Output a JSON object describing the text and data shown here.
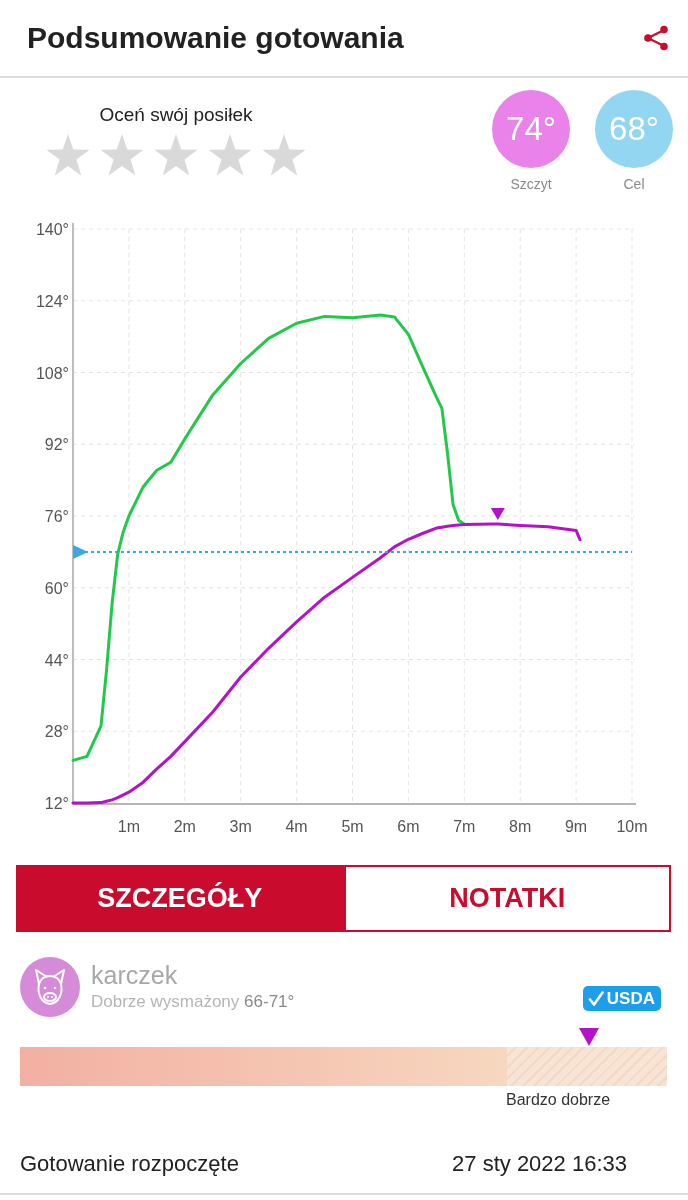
{
  "header": {
    "title": "Podsumowanie gotowania"
  },
  "rating": {
    "label": "Oceń swój posiłek",
    "stars": 0
  },
  "readings": [
    {
      "value": "74°",
      "label": "Szczyt",
      "color": "#e982e9"
    },
    {
      "value": "68°",
      "label": "Cel",
      "color": "#93d6f2"
    }
  ],
  "chart": {
    "chart_data": {
      "type": "line",
      "x": [
        0,
        0.25,
        0.5,
        0.6,
        0.7,
        0.8,
        0.9,
        1,
        1.25,
        1.5,
        1.75,
        2,
        2.5,
        3,
        3.5,
        4,
        4.5,
        5,
        5.5,
        5.75,
        6,
        6.25,
        6.5,
        6.6,
        6.7,
        6.8,
        6.9,
        7,
        7.5,
        7.6,
        8,
        8.5,
        9,
        9.07
      ],
      "series": [
        {
          "color": "#22c84a",
          "values": [
            21.5,
            22.4,
            29.2,
            41.5,
            56.5,
            67.5,
            72.5,
            76,
            82.4,
            86.2,
            88,
            93.2,
            103,
            110,
            115.6,
            119,
            120.5,
            120.2,
            120.8,
            120.4,
            116.5,
            109.4,
            102.5,
            100,
            90,
            78.5,
            75,
            74.2,
            null,
            null,
            null,
            null,
            null,
            null
          ]
        },
        {
          "color": "#b412c8",
          "values": [
            12,
            12,
            12.1,
            12.4,
            12.7,
            13.2,
            13.8,
            14.4,
            16.6,
            19.6,
            22.4,
            25.7,
            32.3,
            40.1,
            46.5,
            52.4,
            57.9,
            62.3,
            66.7,
            69.1,
            70.8,
            72.1,
            73.3,
            73.5,
            73.7,
            73.9,
            74,
            74.1,
            74.2,
            74.2,
            73.9,
            73.6,
            72.8,
            70.7
          ]
        }
      ],
      "xlim": [
        0,
        10
      ],
      "ylim": [
        12,
        140
      ],
      "xticks": [
        {
          "value": 1,
          "label": "1m"
        },
        {
          "value": 2,
          "label": "2m"
        },
        {
          "value": 3,
          "label": "3m"
        },
        {
          "value": 4,
          "label": "4m"
        },
        {
          "value": 5,
          "label": "5m"
        },
        {
          "value": 6,
          "label": "6m"
        },
        {
          "value": 7,
          "label": "7m"
        },
        {
          "value": 8,
          "label": "8m"
        },
        {
          "value": 9,
          "label": "9m"
        },
        {
          "value": 10,
          "label": "10m"
        }
      ],
      "yticks": [
        {
          "value": 12,
          "label": "12°"
        },
        {
          "value": 28,
          "label": "28°"
        },
        {
          "value": 44,
          "label": "44°"
        },
        {
          "value": 60,
          "label": "60°"
        },
        {
          "value": 76,
          "label": "76°"
        },
        {
          "value": 92,
          "label": "92°"
        },
        {
          "value": 108,
          "label": "108°"
        },
        {
          "value": 124,
          "label": "124°"
        },
        {
          "value": 140,
          "label": "140°"
        }
      ],
      "grid": true,
      "ref_lines": [
        {
          "axis": "y",
          "value": 68,
          "color": "#39a8e0"
        }
      ]
    }
  },
  "tabs": [
    {
      "label": "SZCZEGÓŁY",
      "selected": true
    },
    {
      "label": "NOTATKI",
      "selected": false
    }
  ],
  "meat": {
    "name": "karczek",
    "doneness": "Dobrze wysmażony",
    "range": "66-71°",
    "badge": "USDA",
    "scale": {
      "level": 0.88,
      "zone_label": "Bardzo dobrze"
    }
  },
  "footer": {
    "label": "Gotowanie rozpoczęte",
    "value": "27 sty 2022 16:33"
  }
}
